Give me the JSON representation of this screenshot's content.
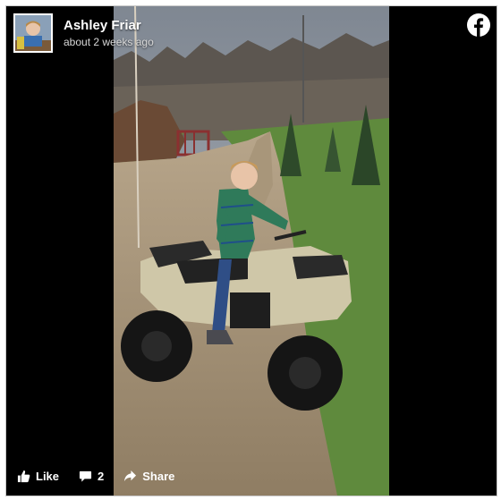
{
  "post": {
    "author": "Ashley Friar",
    "timestamp": "about 2 weeks ago"
  },
  "actions": {
    "like_label": "Like",
    "comment_count": "2",
    "share_label": "Share"
  },
  "icons": {
    "brand": "facebook-logo-icon",
    "like": "thumbs-up-icon",
    "comment": "comment-bubble-icon",
    "share": "share-arrow-icon"
  },
  "colors": {
    "background": "#000000",
    "text": "#ffffff",
    "secondary_text": "#d8d8d8"
  }
}
